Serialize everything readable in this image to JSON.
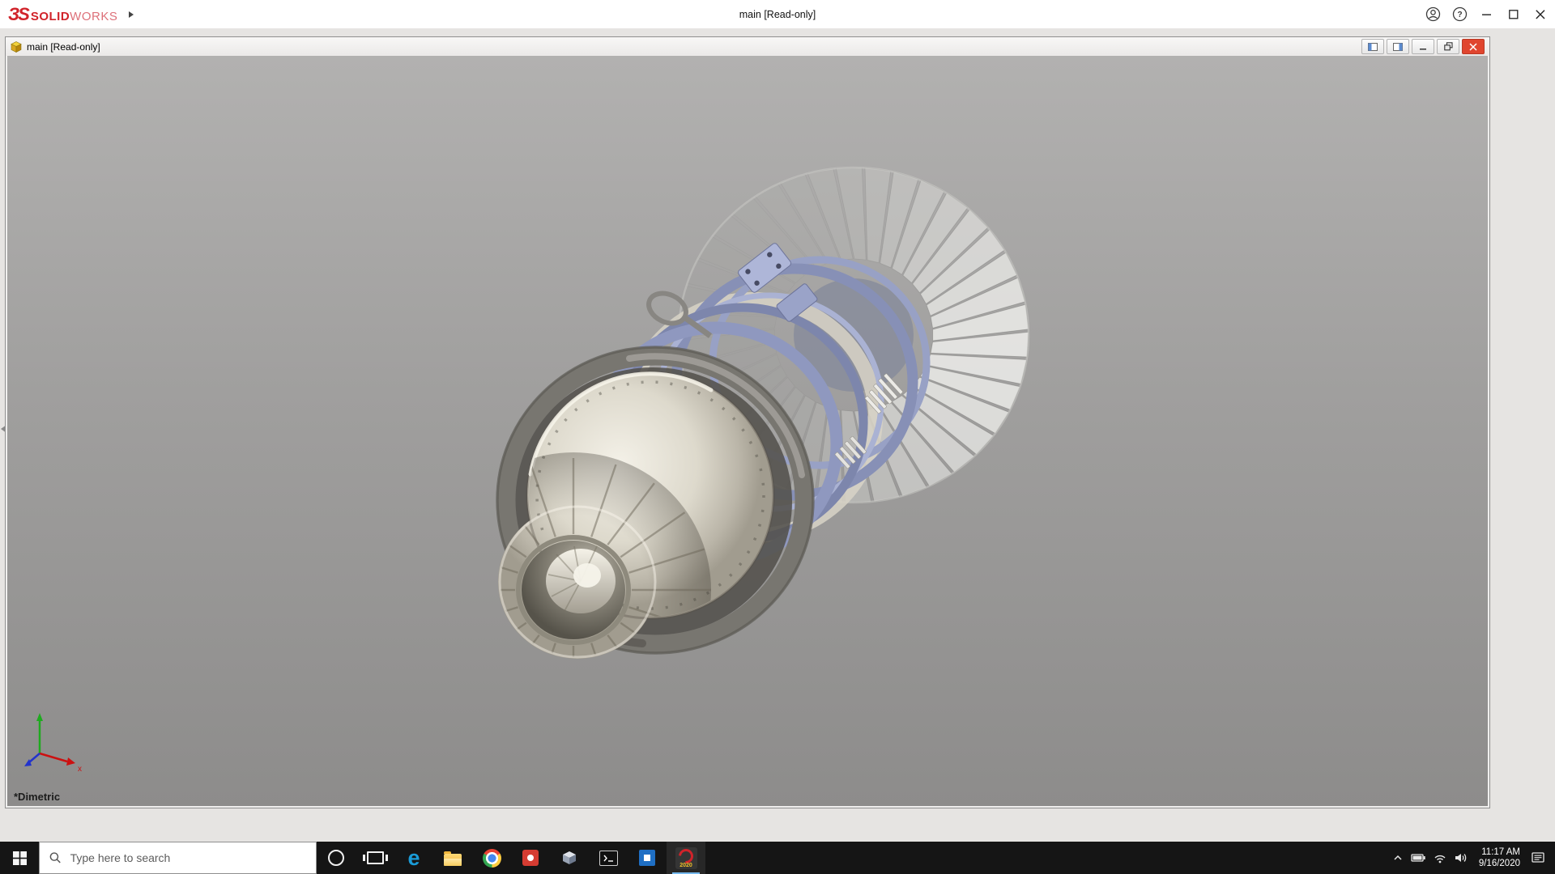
{
  "titlebar": {
    "brand": {
      "mark": "ЗS",
      "solid": "SOLID",
      "works": "WORKS"
    },
    "title": "main [Read-only]"
  },
  "document": {
    "title": "main [Read-only]",
    "view_orientation": "*Dimetric"
  },
  "taskbar": {
    "search_placeholder": "Type here to search",
    "solidworks_year": "2020",
    "clock": {
      "time": "11:17 AM",
      "date": "9/16/2020"
    }
  },
  "icons": {
    "edge_glyph": "e",
    "help_glyph": "?"
  },
  "colors": {
    "brand_red": "#d1232a",
    "doc_close_red": "#e0452e",
    "active_underline": "#76b9ed",
    "viewport_gray_top": "#b2b1b0",
    "viewport_gray_bottom": "#8d8c8b"
  }
}
